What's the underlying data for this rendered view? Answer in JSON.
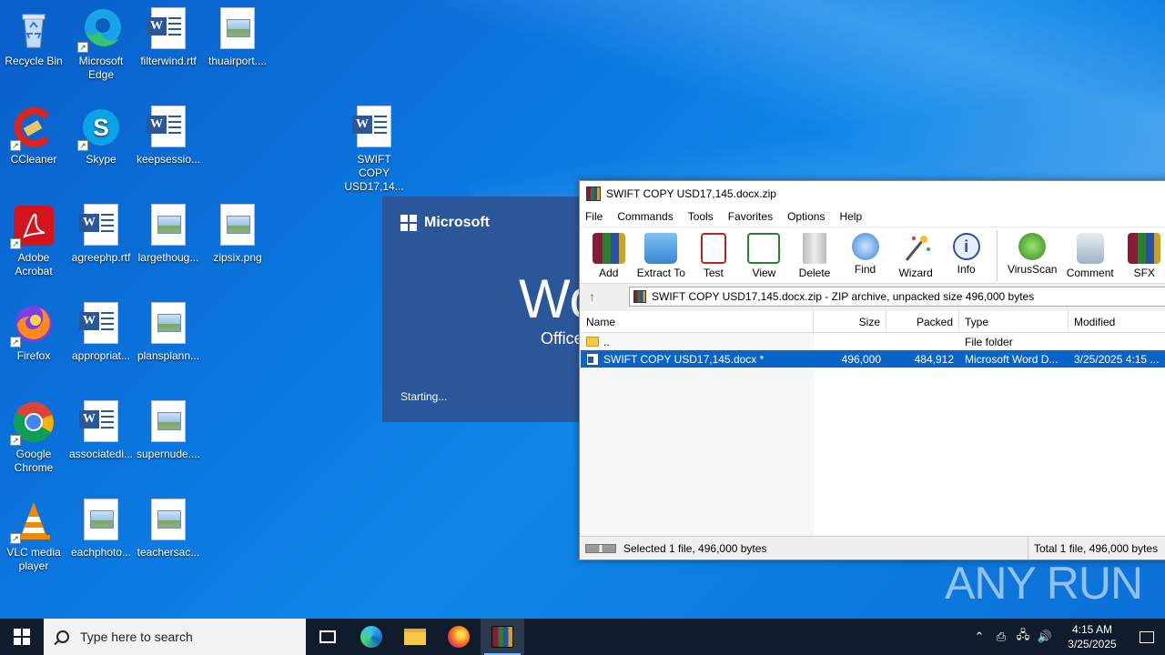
{
  "desktop": {
    "icons": [
      {
        "label": "Recycle Bin"
      },
      {
        "label": "Microsoft Edge"
      },
      {
        "label": "filterwind.rtf"
      },
      {
        "label": "thuairport...."
      },
      {
        "label": "CCleaner"
      },
      {
        "label": "Skype"
      },
      {
        "label": "keepsessio..."
      },
      {
        "label": "SWIFT COPY USD17,14..."
      },
      {
        "label": "Adobe Acrobat"
      },
      {
        "label": "agreephp.rtf"
      },
      {
        "label": "largethoug..."
      },
      {
        "label": "zipsix.png"
      },
      {
        "label": "Firefox"
      },
      {
        "label": "appropriat..."
      },
      {
        "label": "plansplann..."
      },
      {
        "label": "Google Chrome"
      },
      {
        "label": "associatedi..."
      },
      {
        "label": "supernude...."
      },
      {
        "label": "VLC media player"
      },
      {
        "label": "eachphoto..."
      },
      {
        "label": "teachersac..."
      }
    ]
  },
  "splash": {
    "brand": "Microsoft",
    "big_text": "Wo",
    "office": "Office",
    "status": "Starting..."
  },
  "archive_window": {
    "title": "SWIFT COPY  USD17,145.docx.zip",
    "menu": [
      "File",
      "Commands",
      "Tools",
      "Favorites",
      "Options",
      "Help"
    ],
    "toolbar": [
      "Add",
      "Extract To",
      "Test",
      "View",
      "Delete",
      "Find",
      "Wizard",
      "Info",
      "VirusScan",
      "Comment",
      "SFX"
    ],
    "path": "SWIFT COPY  USD17,145.docx.zip - ZIP archive, unpacked size 496,000 bytes",
    "columns": [
      "Name",
      "Size",
      "Packed",
      "Type",
      "Modified"
    ],
    "rows": [
      {
        "name": "..",
        "size": "",
        "packed": "",
        "type": "File folder",
        "modified": ""
      },
      {
        "name": "SWIFT COPY  USD17,145.docx *",
        "size": "496,000",
        "packed": "484,912",
        "type": "Microsoft Word D...",
        "modified": "3/25/2025 4:15 ..."
      }
    ],
    "status_left": "Selected 1 file, 496,000 bytes",
    "status_right": "Total 1 file, 496,000 bytes"
  },
  "watermark": "ANY  RUN",
  "taskbar": {
    "search_placeholder": "Type here to search",
    "time": "4:15 AM",
    "date": "3/25/2025"
  },
  "colors": {
    "desktop": "#0b77e0",
    "selection": "#0a64c8",
    "taskbar": "#101c2c",
    "splash": "#2b579a"
  }
}
